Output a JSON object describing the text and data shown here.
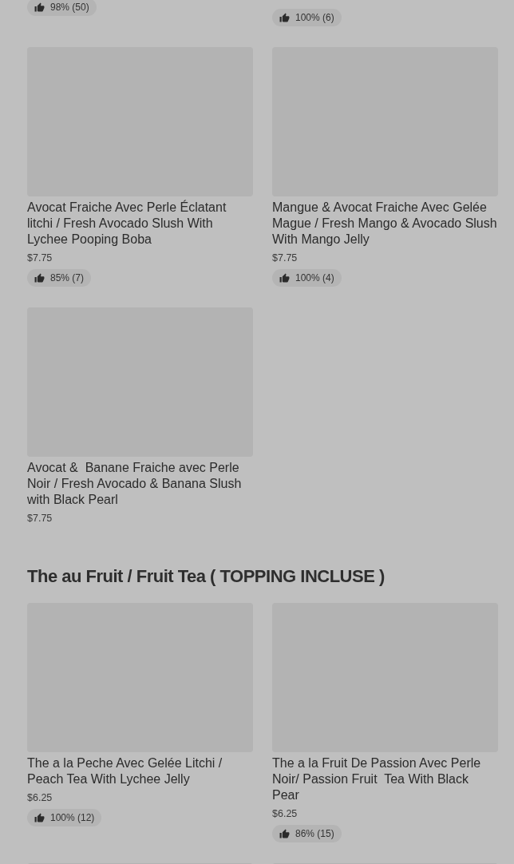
{
  "sections": [
    {
      "items": [
        {
          "kind": "tail",
          "rating": "98% (50)"
        },
        {
          "kind": "tail_low",
          "rating": "100% (6)"
        },
        {
          "kind": "full",
          "title": "Avocat Fraiche Avec Perle Éclatant litchi / Fresh Avocado Slush With Lychee Pooping Boba",
          "price": "$7.75",
          "rating": "85% (7)"
        },
        {
          "kind": "full",
          "title": "Mangue & Avocat Fraiche Avec Gelée Mague / Fresh Mango & Avocado Slush With Mango Jelly",
          "price": "$7.75",
          "rating": "100% (4)"
        },
        {
          "kind": "full",
          "title": "Avocat &  Banane Fraiche avec Perle Noir / Fresh Avocado & Banana Slush with Black Pearl",
          "price": "$7.75"
        }
      ]
    },
    {
      "title": "The au Fruit / Fruit Tea ( TOPPING INCLUSE )",
      "items": [
        {
          "kind": "full",
          "title": "The a la Peche Avec Gelée Litchi / Peach Tea With Lychee Jelly",
          "price": "$6.25",
          "rating": "100% (12)"
        },
        {
          "kind": "full",
          "title": "The a la Fruit De Passion Avec Perle Noir/ Passion Fruit  Tea With Black Pear",
          "price": "$6.25",
          "rating": "86% (15)"
        },
        {
          "kind": "head"
        },
        {
          "kind": "head"
        }
      ]
    }
  ]
}
